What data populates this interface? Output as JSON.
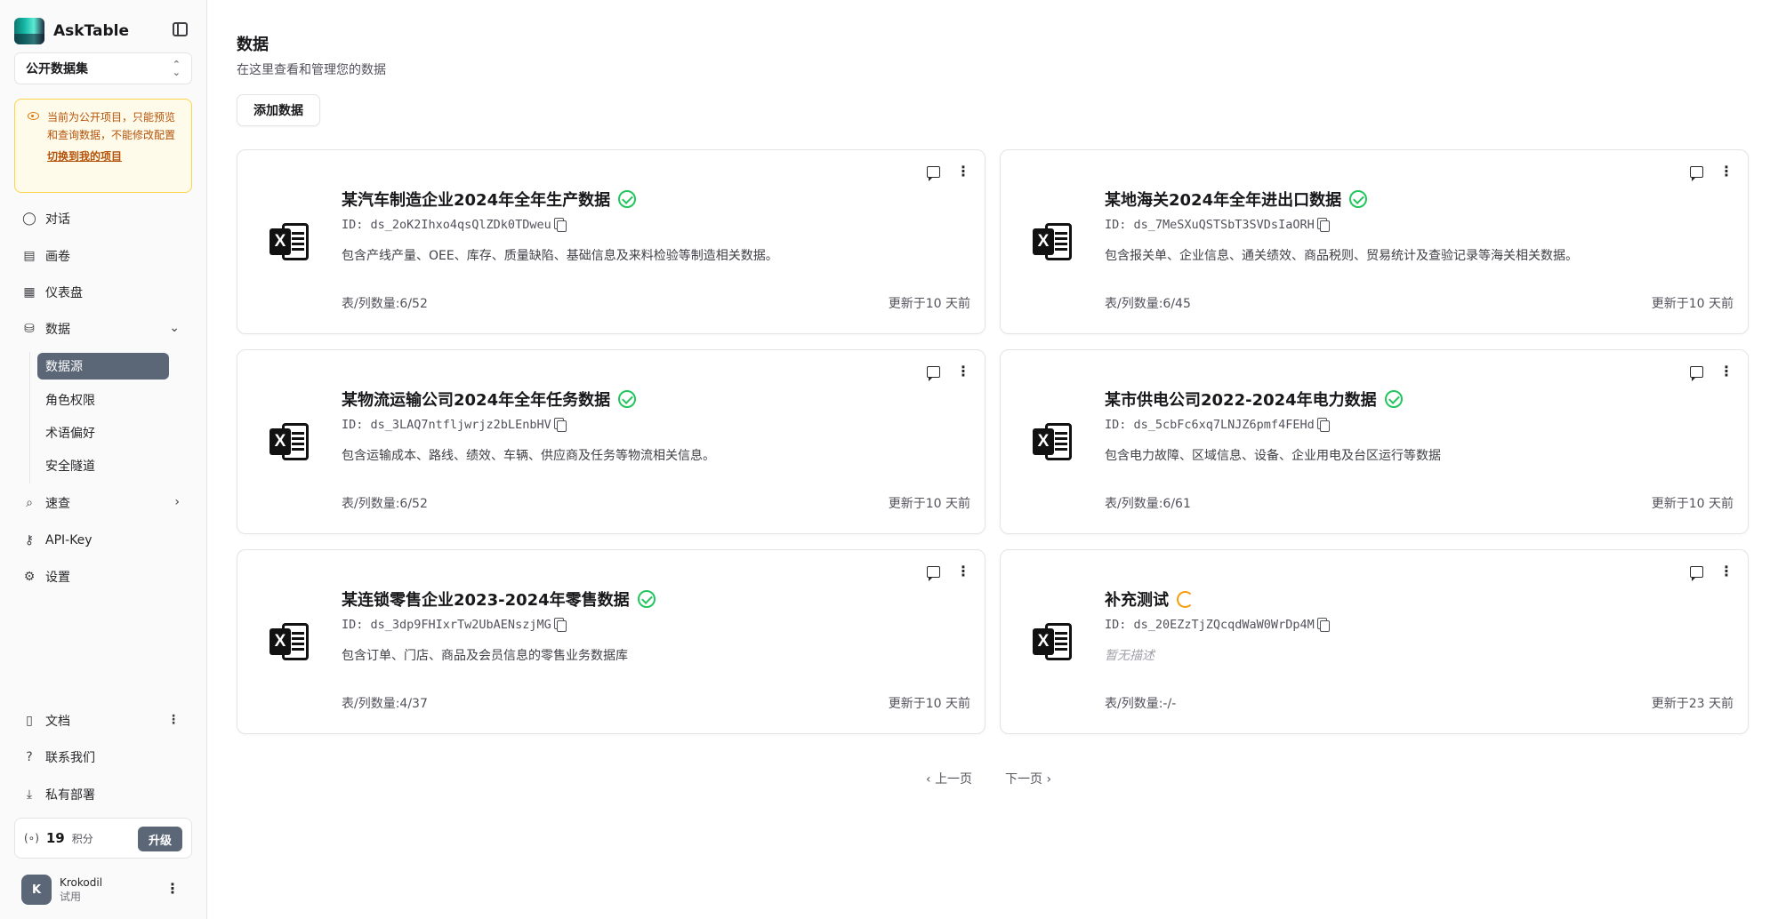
{
  "app": {
    "name": "AskTable"
  },
  "project_select": {
    "label": "公开数据集"
  },
  "notice": {
    "text": "当前为公开项目，只能预览和查询数据，不能修改配置",
    "link": "切换到我的项目"
  },
  "nav": {
    "chat": "对话",
    "canvas": "画卷",
    "dashboard": "仪表盘",
    "data": "数据",
    "data_sub": [
      "数据源",
      "角色权限",
      "术语偏好",
      "安全隧道"
    ],
    "quick": "速查",
    "apikey": "API-Key",
    "settings": "设置",
    "docs": "文档",
    "contact": "联系我们",
    "deploy": "私有部署"
  },
  "credits": {
    "value": "19",
    "unit": "积分",
    "upgrade": "升级"
  },
  "user": {
    "initial": "K",
    "name": "Krokodil",
    "plan": "试用"
  },
  "page": {
    "title": "数据",
    "subtitle": "在这里查看和管理您的数据",
    "add_button": "添加数据"
  },
  "datasources": [
    {
      "title": "某汽车制造企业2024年全年生产数据",
      "status": "ready",
      "id": "ID: ds_2oK2Ihxo4qsQlZDk0TDweu",
      "desc": "包含产线产量、OEE、库存、质量缺陷、基础信息及来料检验等制造相关数据。",
      "count": "表/列数量:6/52",
      "updated": "更新于10 天前"
    },
    {
      "title": "某地海关2024年全年进出口数据",
      "status": "ready",
      "id": "ID: ds_7MeSXuQSTSbT3SVDsIaORH",
      "desc": "包含报关单、企业信息、通关绩效、商品税则、贸易统计及查验记录等海关相关数据。",
      "count": "表/列数量:6/45",
      "updated": "更新于10 天前"
    },
    {
      "title": "某物流运输公司2024年全年任务数据",
      "status": "ready",
      "id": "ID: ds_3LAQ7ntfljwrjz2bLEnbHV",
      "desc": "包含运输成本、路线、绩效、车辆、供应商及任务等物流相关信息。",
      "count": "表/列数量:6/52",
      "updated": "更新于10 天前"
    },
    {
      "title": "某市供电公司2022-2024年电力数据",
      "status": "ready",
      "id": "ID: ds_5cbFc6xq7LNJZ6pmf4FEHd",
      "desc": "包含电力故障、区域信息、设备、企业用电及台区运行等数据",
      "count": "表/列数量:6/61",
      "updated": "更新于10 天前"
    },
    {
      "title": "某连锁零售企业2023-2024年零售数据",
      "status": "ready",
      "id": "ID: ds_3dp9FHIxrTw2UbAENszjMG",
      "desc": "包含订单、门店、商品及会员信息的零售业务数据库",
      "count": "表/列数量:4/37",
      "updated": "更新于10 天前"
    },
    {
      "title": "补充测试",
      "status": "loading",
      "id": "ID: ds_20EZzTjZQcqdWaW0WrDp4M",
      "desc": "暂无描述",
      "count": "表/列数量:-/-",
      "updated": "更新于23 天前"
    }
  ],
  "pagination": {
    "prev": "上一页",
    "next": "下一页"
  },
  "colors": {
    "accent": "#5b6677",
    "success": "#22c55e",
    "pending": "#f59e0b",
    "warning_bg": "#fffbeb",
    "warning_text": "#b45309"
  }
}
